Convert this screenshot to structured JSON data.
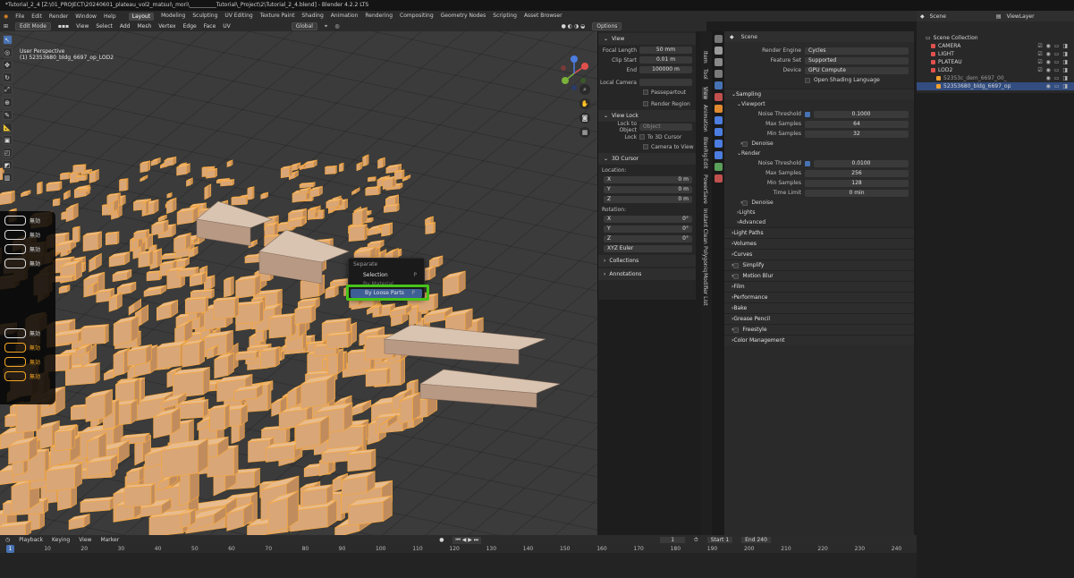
{
  "window": {
    "title": "*Tutorial_2_4 [Z:\\01_PROJECT\\20240601_plateau_vol2_matsui\\_mori\\__________Tutorial\\_Project\\2\\Tutorial_2_4.blend] - Blender 4.2.2 LTS"
  },
  "menubar": {
    "items": [
      "File",
      "Edit",
      "Render",
      "Window",
      "Help"
    ],
    "workspaces": [
      "Layout",
      "Modeling",
      "Sculpting",
      "UV Editing",
      "Texture Paint",
      "Shading",
      "Animation",
      "Rendering",
      "Compositing",
      "Geometry Nodes",
      "Scripting",
      "Asset Browser"
    ],
    "active_workspace": "Layout"
  },
  "viewport_header": {
    "mode": "Edit Mode",
    "menus": [
      "View",
      "Select",
      "Add",
      "Mesh",
      "Vertex",
      "Edge",
      "Face",
      "UV"
    ],
    "orientation": "Global",
    "options": "Options"
  },
  "viewport": {
    "perspective": "User Perspective",
    "object_label": "(1) 52353680_bldg_6697_op_LOD2"
  },
  "overlay_keys": {
    "rows": [
      "無効",
      "無効",
      "無効",
      "無効",
      "無効",
      "無効",
      "無効",
      "無効"
    ]
  },
  "context_menu": {
    "title": "Separate",
    "items": [
      {
        "label": "Selection",
        "shortcut": "P"
      },
      {
        "label": "By Material",
        "shortcut": ""
      },
      {
        "label": "By Loose Parts",
        "shortcut": "P"
      }
    ],
    "highlight_color": "#46c31a"
  },
  "npanel": {
    "view": {
      "title": "View",
      "focal_length_label": "Focal Length",
      "focal_length": "50 mm",
      "clip_start_label": "Clip Start",
      "clip_start": "0.01 m",
      "end_label": "End",
      "end": "100000 m",
      "local_camera_label": "Local Camera",
      "passepartout": "Passepartout",
      "render_region": "Render Region"
    },
    "view_lock": {
      "title": "View Lock",
      "lock_to_object_label": "Lock to Object",
      "object_placeholder": "Object",
      "lock_label": "Lock",
      "to_3d_cursor": "To 3D Cursor",
      "camera_to_view": "Camera to View"
    },
    "cursor": {
      "title": "3D Cursor",
      "location_label": "Location:",
      "x_label": "X",
      "x": "0 m",
      "y_label": "Y",
      "y": "0 m",
      "z_label": "Z",
      "z": "0 m",
      "rotation_label": "Rotation:",
      "rx": "0°",
      "ry": "0°",
      "rz": "0°",
      "rot_mode": "XYZ Euler"
    },
    "collections": "Collections",
    "annotations": "Annotations",
    "tabs": [
      "Item",
      "Tool",
      "View",
      "Animation",
      "BlenRig",
      "Edit",
      "PowerSave",
      "Instant Clean",
      "Polygoniq",
      "Modifier List"
    ]
  },
  "properties": {
    "header": "Scene",
    "render_engine_label": "Render Engine",
    "render_engine": "Cycles",
    "feature_set_label": "Feature Set",
    "feature_set": "Supported",
    "device_label": "Device",
    "device": "GPU Compute",
    "osl": "Open Shading Language",
    "sampling": "Sampling",
    "viewport": "Viewport",
    "noise_threshold_label": "Noise Threshold",
    "vp_noise": "0.1000",
    "max_samples_label": "Max Samples",
    "vp_max": "64",
    "min_samples_label": "Min Samples",
    "vp_min": "32",
    "denoise": "Denoise",
    "render": "Render",
    "r_noise": "0.0100",
    "r_max": "256",
    "r_min": "128",
    "time_limit_label": "Time Limit",
    "r_time": "0 min",
    "lights": "Lights",
    "advanced": "Advanced",
    "sections": [
      "Light Paths",
      "Volumes",
      "Curves",
      "Simplify",
      "Motion Blur",
      "Film",
      "Performance",
      "Bake",
      "Grease Pencil",
      "Freestyle",
      "Color Management"
    ]
  },
  "outliner": {
    "scene": "Scene",
    "viewlayer": "ViewLayer",
    "root": "Scene Collection",
    "items": [
      {
        "name": "CAMERA",
        "color": "#e0504e"
      },
      {
        "name": "LIGHT",
        "color": "#e0504e"
      },
      {
        "name": "PLATEAU",
        "color": "#e0504e"
      },
      {
        "name": "LOD2",
        "color": "#e0504e"
      },
      {
        "name": "52353c_dem_6697_00_",
        "color": "#f0a030"
      },
      {
        "name": "52353680_bldg_6697_op",
        "color": "#f0a030"
      }
    ]
  },
  "timeline": {
    "menus": [
      "Playback",
      "Keying",
      "View",
      "Marker"
    ],
    "current": "1",
    "start_label": "Start",
    "start": "1",
    "end_label": "End",
    "end": "240",
    "ticks": [
      "1",
      "10",
      "20",
      "30",
      "40",
      "50",
      "60",
      "70",
      "80",
      "90",
      "100",
      "110",
      "120",
      "130",
      "140",
      "150",
      "160",
      "170",
      "180",
      "190",
      "200",
      "210",
      "220",
      "230",
      "240"
    ]
  }
}
